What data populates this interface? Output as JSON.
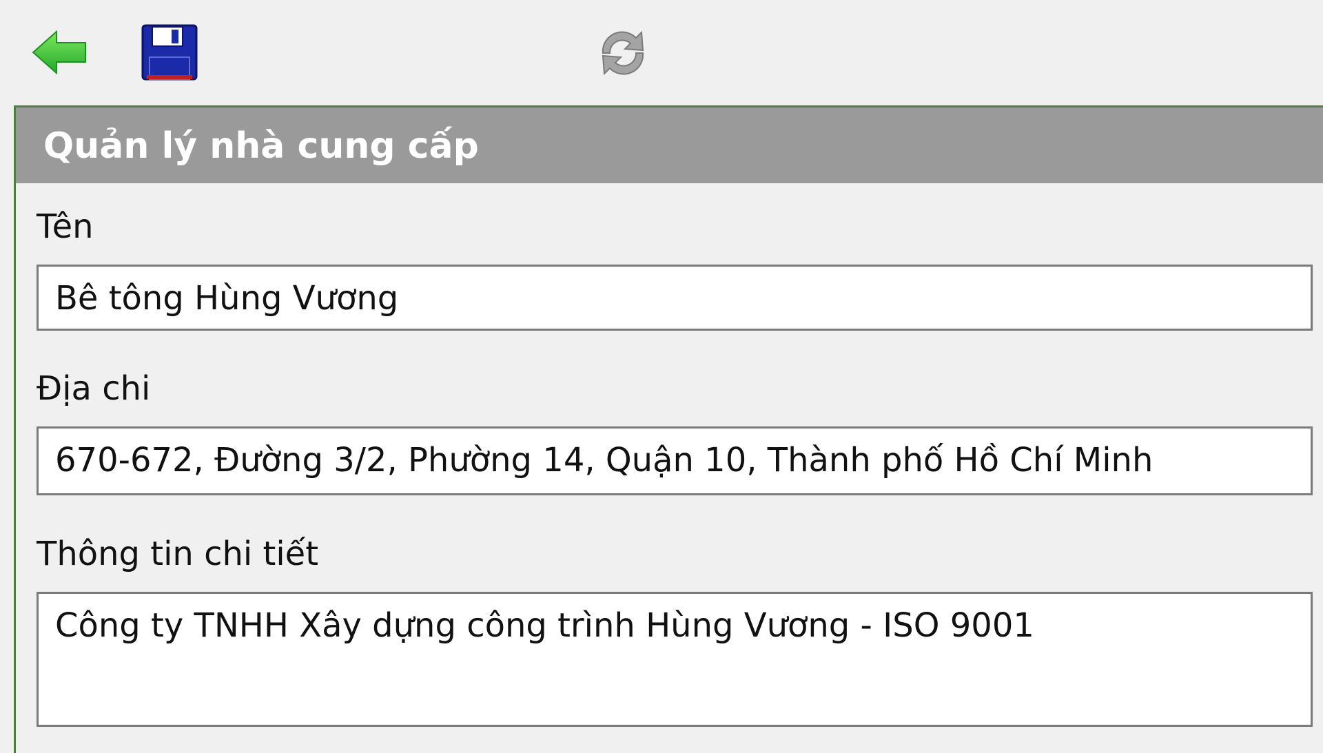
{
  "toolbar": {
    "back_icon": "back-arrow-icon",
    "save_icon": "floppy-disk-icon",
    "refresh_icon": "refresh-icon",
    "colors": {
      "back": "#3cc23c",
      "save": "#1a2aa8",
      "refresh": "#9a9a9a"
    }
  },
  "panel": {
    "title": "Quản lý nhà cung cấp",
    "header_color": "#9a9a9a",
    "border_color": "#4f7e42"
  },
  "form": {
    "name_label": "Tên",
    "name_value": "Bê tông Hùng Vương",
    "address_label": "Địa chi",
    "address_value": "670-672, Đường 3/2, Phường 14, Quận 10, Thành phố Hồ Chí Minh",
    "details_label": "Thông tin chi tiết",
    "details_value": "Công ty TNHH Xây dựng công trình Hùng Vương - ISO 9001"
  }
}
